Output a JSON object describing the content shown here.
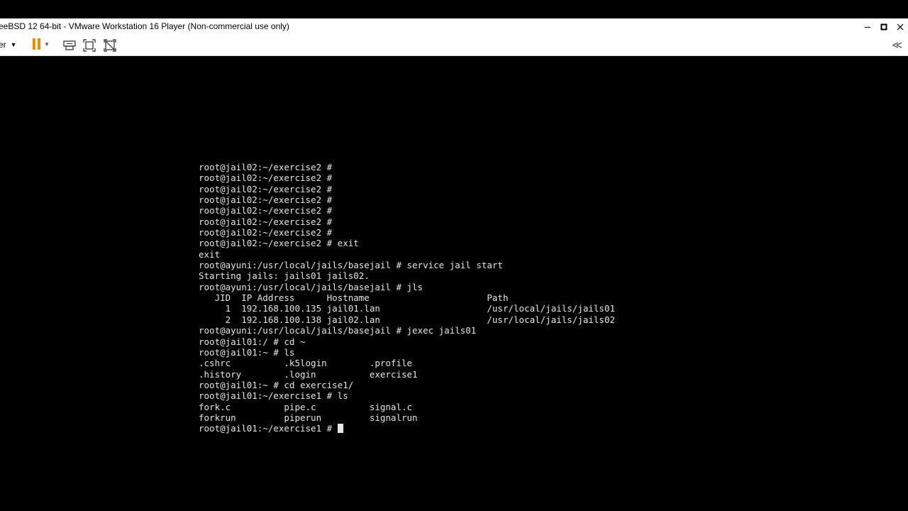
{
  "window": {
    "title": "reeBSD 12 64-bit - VMware Workstation 16 Player (Non-commercial use only)"
  },
  "toolbar": {
    "player_label": "er"
  },
  "icons": {
    "minimize": "minimize-icon",
    "maximize": "maximize-icon",
    "close": "close-icon",
    "pause": "pause-icon",
    "send_keys": "send-ctrl-alt-del-icon",
    "fullscreen": "fullscreen-icon",
    "unity": "unity-icon",
    "collapse": "collapse-toolbar-icon"
  },
  "colors": {
    "pause_accent": "#f08a00",
    "terminal_fg": "#e6e6e6",
    "terminal_bg": "#000000"
  },
  "terminal": {
    "lines": [
      "root@jail02:~/exercise2 #",
      "root@jail02:~/exercise2 #",
      "root@jail02:~/exercise2 #",
      "root@jail02:~/exercise2 #",
      "root@jail02:~/exercise2 #",
      "root@jail02:~/exercise2 #",
      "root@jail02:~/exercise2 #",
      "root@jail02:~/exercise2 # exit",
      "exit",
      "root@ayuni:/usr/local/jails/basejail # service jail start",
      "Starting jails: jails01 jails02.",
      "root@ayuni:/usr/local/jails/basejail # jls",
      "   JID  IP Address      Hostname                      Path",
      "     1  192.168.100.135 jail01.lan                    /usr/local/jails/jails01",
      "     2  192.168.100.138 jail02.lan                    /usr/local/jails/jails02",
      "root@ayuni:/usr/local/jails/basejail # jexec jails01",
      "root@jail01:/ # cd ~",
      "root@jail01:~ # ls",
      ".cshrc          .k5login        .profile",
      ".history        .login          exercise1",
      "root@jail01:~ # cd exercise1/",
      "root@jail01:~/exercise1 # ls",
      "fork.c          pipe.c          signal.c",
      "forkrun         piperun         signalrun"
    ],
    "prompt": "root@jail01:~/exercise1 # "
  }
}
